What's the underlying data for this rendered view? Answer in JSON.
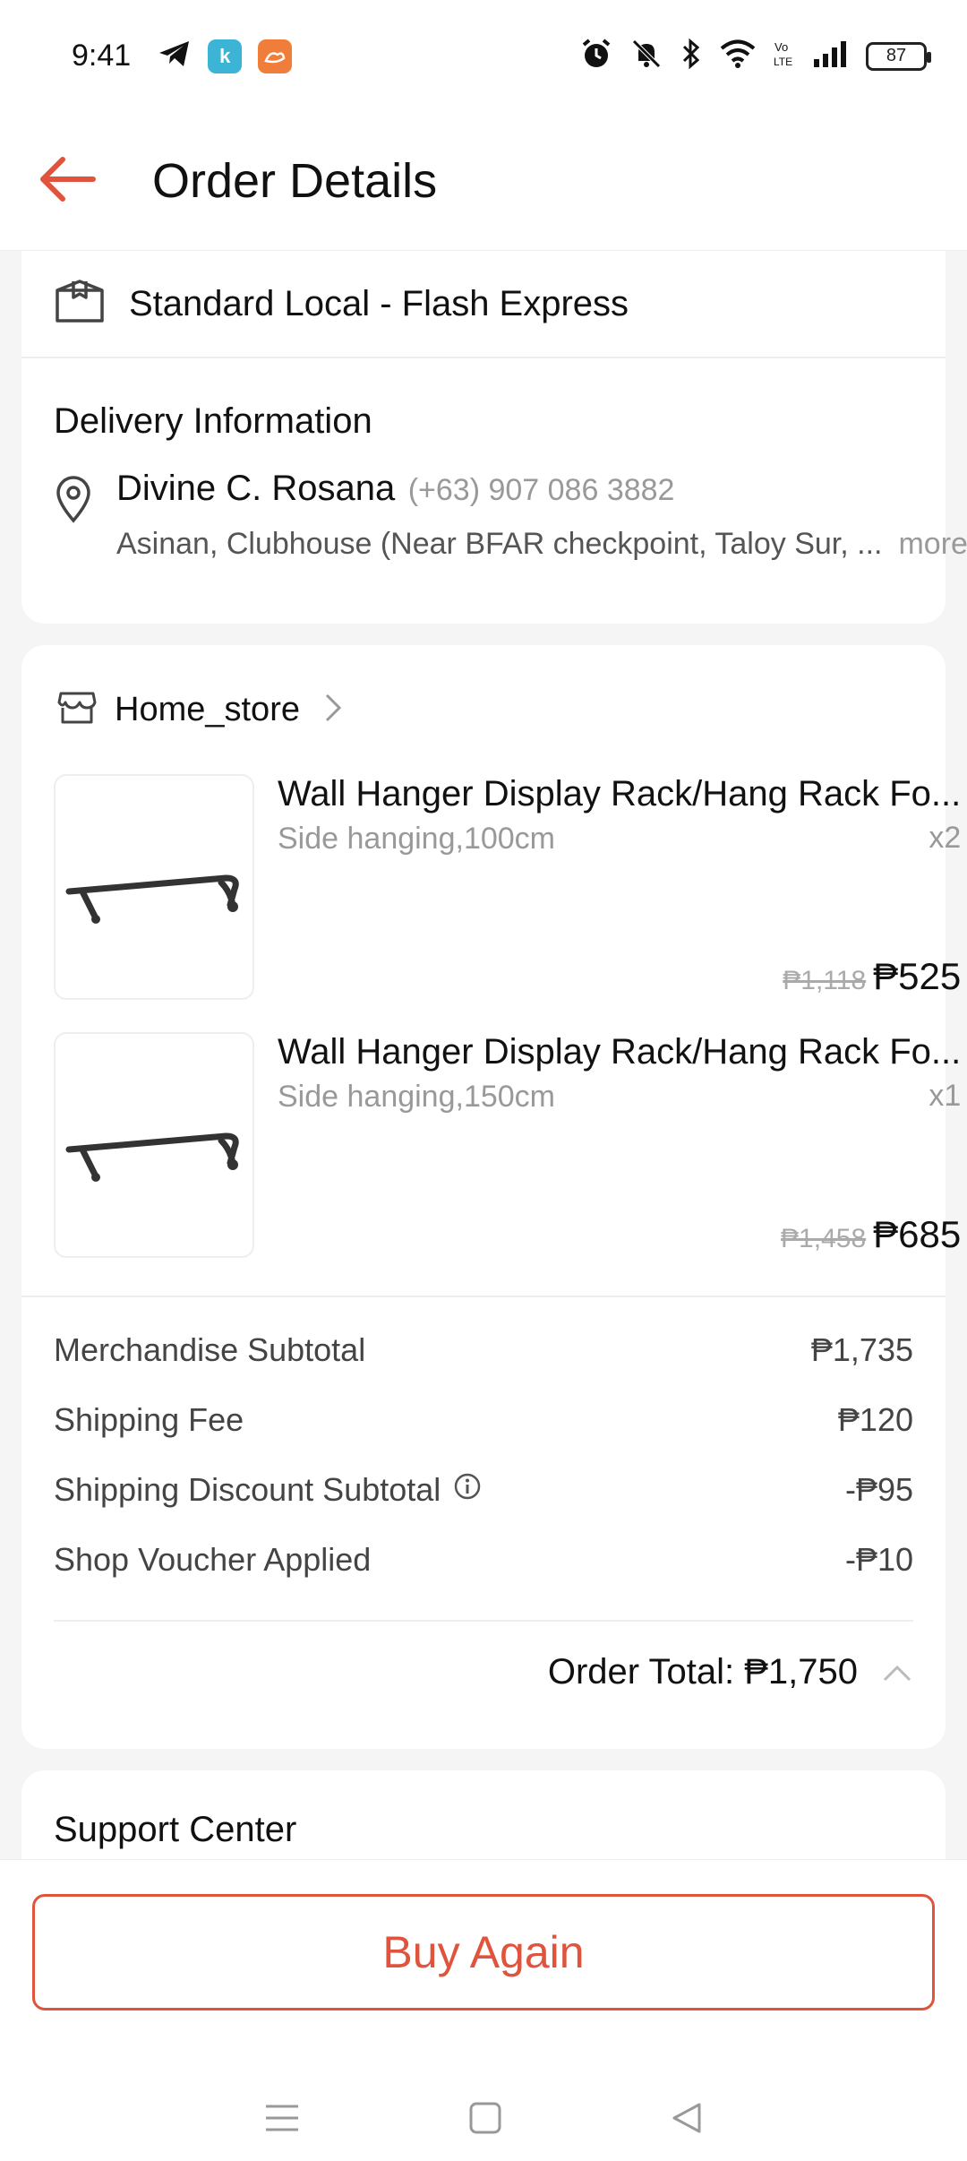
{
  "status_bar": {
    "time": "9:41",
    "battery": "87",
    "icons": [
      "telegram-icon",
      "app-icon-blue",
      "app-icon-orange",
      "alarm-icon",
      "mute-icon",
      "bluetooth-icon",
      "wifi-icon",
      "volte-icon",
      "signal-icon",
      "battery-icon"
    ]
  },
  "header": {
    "title": "Order Details"
  },
  "shipping": {
    "method": "Standard Local - Flash Express"
  },
  "delivery": {
    "title": "Delivery Information",
    "name": "Divine C. Rosana",
    "phone": "(+63) 907 086 3882",
    "address": "Asinan, Clubhouse (Near BFAR checkpoint, Taloy Sur, ...",
    "more_label": "more"
  },
  "shop": {
    "name": "Home_store"
  },
  "products": [
    {
      "name": "Wall Hanger Display Rack/Hang Rack Fo...",
      "variation": "Side hanging,100cm",
      "qty": "x2",
      "original_price": "₱1,118",
      "price": "₱525"
    },
    {
      "name": "Wall Hanger Display Rack/Hang Rack Fo...",
      "variation": "Side hanging,150cm",
      "qty": "x1",
      "original_price": "₱1,458",
      "price": "₱685"
    }
  ],
  "summary": {
    "rows": [
      {
        "label": "Merchandise Subtotal",
        "value": "₱1,735"
      },
      {
        "label": "Shipping Fee",
        "value": "₱120"
      },
      {
        "label": "Shipping Discount Subtotal",
        "value": "-₱95"
      },
      {
        "label": "Shop Voucher Applied",
        "value": "-₱10"
      }
    ],
    "total_label": "Order Total: ₱1,750"
  },
  "support": {
    "title": "Support Center"
  },
  "actions": {
    "buy_again": "Buy Again"
  },
  "colors": {
    "accent": "#e0533c",
    "app_blue": "#3cb4d6",
    "app_orange": "#f07d3a"
  }
}
